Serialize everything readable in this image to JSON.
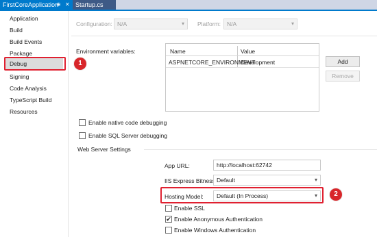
{
  "tabs": [
    {
      "label": "FirstCoreApplication",
      "pin_icon": "⊕",
      "close_icon": "✕"
    },
    {
      "label": "Startup.cs"
    }
  ],
  "sidebar": {
    "items": [
      {
        "label": "Application"
      },
      {
        "label": "Build"
      },
      {
        "label": "Build Events"
      },
      {
        "label": "Package"
      },
      {
        "label": "Debug"
      },
      {
        "label": "Signing"
      },
      {
        "label": "Code Analysis"
      },
      {
        "label": "TypeScript Build"
      },
      {
        "label": "Resources"
      }
    ],
    "selected": "Debug"
  },
  "callouts": {
    "one": "1",
    "two": "2",
    "color": "#d8262a"
  },
  "config": {
    "configuration_label": "Configuration:",
    "configuration_value": "N/A",
    "platform_label": "Platform:",
    "platform_value": "N/A"
  },
  "env": {
    "label": "Environment variables:",
    "col_name": "Name",
    "col_value": "Value",
    "rows": [
      {
        "name": "ASPNETCORE_ENVIRONMENT",
        "value": "Development"
      }
    ],
    "add_label": "Add",
    "remove_label": "Remove"
  },
  "checks": {
    "native": {
      "label": "Enable native code debugging",
      "checked": false
    },
    "sql": {
      "label": "Enable SQL Server debugging",
      "checked": false
    }
  },
  "web": {
    "section_label": "Web Server Settings",
    "app_url_label": "App URL:",
    "app_url_value": "http://localhost:62742",
    "bitness_label": "IIS Express Bitness:",
    "bitness_value": "Default",
    "hosting_label": "Hosting Model:",
    "hosting_value": "Default (In Process)",
    "ssl": {
      "label": "Enable SSL",
      "checked": false
    },
    "anon": {
      "label": "Enable Anonymous Authentication",
      "checked": true,
      "mark": "✔"
    },
    "windows": {
      "label": "Enable Windows Authentication",
      "checked": false
    }
  },
  "colors": {
    "accent": "#007acc",
    "highlight": "#e02030",
    "selected_bg": "#dcdcdc"
  }
}
